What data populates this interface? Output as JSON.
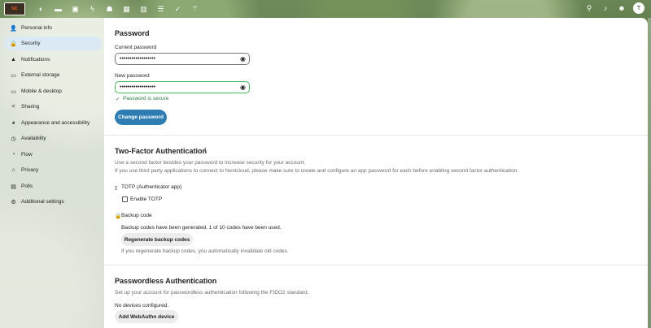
{
  "header": {
    "logo_text": "NC",
    "app_icons": [
      "dashboard-icon",
      "files-icon",
      "photos-icon",
      "activity-icon",
      "contacts-icon",
      "calendar-icon",
      "analytics-icon",
      "deck-icon",
      "tasks-icon",
      "forms-icon"
    ],
    "right_icons": [
      "search-icon",
      "notifications-icon",
      "contacts-menu-icon"
    ],
    "avatar_initial": "T"
  },
  "sidebar": {
    "items": [
      {
        "label": "Personal info",
        "icon": "person-icon"
      },
      {
        "label": "Security",
        "icon": "lock-icon"
      },
      {
        "label": "Notifications",
        "icon": "bell-icon"
      },
      {
        "label": "External storage",
        "icon": "storage-icon"
      },
      {
        "label": "Mobile & desktop",
        "icon": "devices-icon"
      },
      {
        "label": "Sharing",
        "icon": "share-icon"
      },
      {
        "label": "Appearance and accessibility",
        "icon": "palette-icon"
      },
      {
        "label": "Availability",
        "icon": "clock-icon"
      },
      {
        "label": "Flow",
        "icon": "flow-icon"
      },
      {
        "label": "Privacy",
        "icon": "privacy-icon"
      },
      {
        "label": "Polls",
        "icon": "polls-icon"
      },
      {
        "label": "Additional settings",
        "icon": "gear-icon"
      }
    ],
    "active_index": 1
  },
  "password": {
    "title": "Password",
    "current_label": "Current password",
    "current_value": "••••••••••••••••••",
    "new_label": "New password",
    "new_value": "••••••••••••••••••",
    "secure_text": "Password is secure",
    "change_button": "Change password"
  },
  "twofactor": {
    "title": "Two-Factor Authentication",
    "desc1": "Use a second factor besides your password to increase security for your account.",
    "desc2": "If you use third party applications to connect to Nextcloud, please make sure to create and configure an app password for each before enabling second factor authentication.",
    "totp_title": "TOTP (Authenticator app)",
    "totp_checkbox": "Enable TOTP",
    "backup_title": "Backup code",
    "backup_status": "Backup codes have been generated. 1 of 10 codes have been used.",
    "regenerate_button": "Regenerate backup codes",
    "regenerate_note": "If you regenerate backup codes, you automatically invalidate old codes."
  },
  "passwordless": {
    "title": "Passwordless Authentication",
    "desc": "Set up your account for passwordless authentication following the FIDO2 standard.",
    "status": "No devices configured.",
    "add_button": "Add WebAuthn device"
  },
  "colors": {
    "primary": "#2d7db3",
    "success": "#46ba61",
    "active_nav": "#dbe9f5"
  }
}
